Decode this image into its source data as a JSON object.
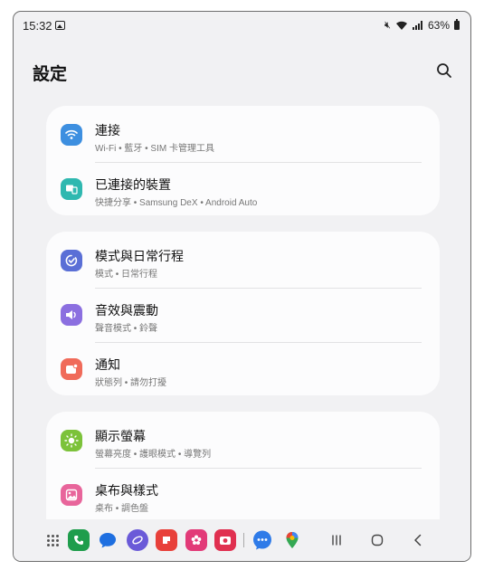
{
  "status_bar": {
    "time": "15:32",
    "battery_text": "63%"
  },
  "header": {
    "title": "設定"
  },
  "groups": [
    {
      "items": [
        {
          "title": "連接",
          "subtitle": "Wi-Fi  •  藍牙  •  SIM 卡管理工具",
          "icon": "wifi-icon",
          "color": "#3d8fe0"
        },
        {
          "title": "已連接的裝置",
          "subtitle": "快捷分享  •  Samsung DeX  •  Android Auto",
          "icon": "connected-devices-icon",
          "color": "#2fb8b0"
        }
      ]
    },
    {
      "items": [
        {
          "title": "模式與日常行程",
          "subtitle": "模式  •  日常行程",
          "icon": "modes-routines-icon",
          "color": "#5a6fd6"
        },
        {
          "title": "音效與震動",
          "subtitle": "聲音模式  •  鈴聲",
          "icon": "sound-icon",
          "color": "#8b6fe0"
        },
        {
          "title": "通知",
          "subtitle": "狀態列  •  請勿打擾",
          "icon": "notification-icon",
          "color": "#f06b5a"
        }
      ]
    },
    {
      "items": [
        {
          "title": "顯示螢幕",
          "subtitle": "螢幕亮度  •  護眼模式  •  導覽列",
          "icon": "display-icon",
          "color": "#7cc23a"
        },
        {
          "title": "桌布與樣式",
          "subtitle": "桌布  •  調色盤",
          "icon": "wallpaper-icon",
          "color": "#e8659b"
        }
      ]
    }
  ],
  "navbar": {
    "apps": [
      {
        "icon": "phone-app-icon",
        "color": "#1f9d4c"
      },
      {
        "icon": "messages-app-icon",
        "color": "#1e6fe0"
      },
      {
        "icon": "internet-app-icon",
        "color": "#6a5ad8"
      },
      {
        "icon": "notes-app-icon",
        "color": "#e8403a"
      },
      {
        "icon": "flower-app-icon",
        "color": "#e23a78"
      },
      {
        "icon": "camera-app-icon",
        "color": "#e03050"
      },
      {
        "icon": "chat-app-icon",
        "color": "#2f7be8"
      },
      {
        "icon": "maps-app-icon",
        "color": "#ffffff"
      }
    ]
  }
}
